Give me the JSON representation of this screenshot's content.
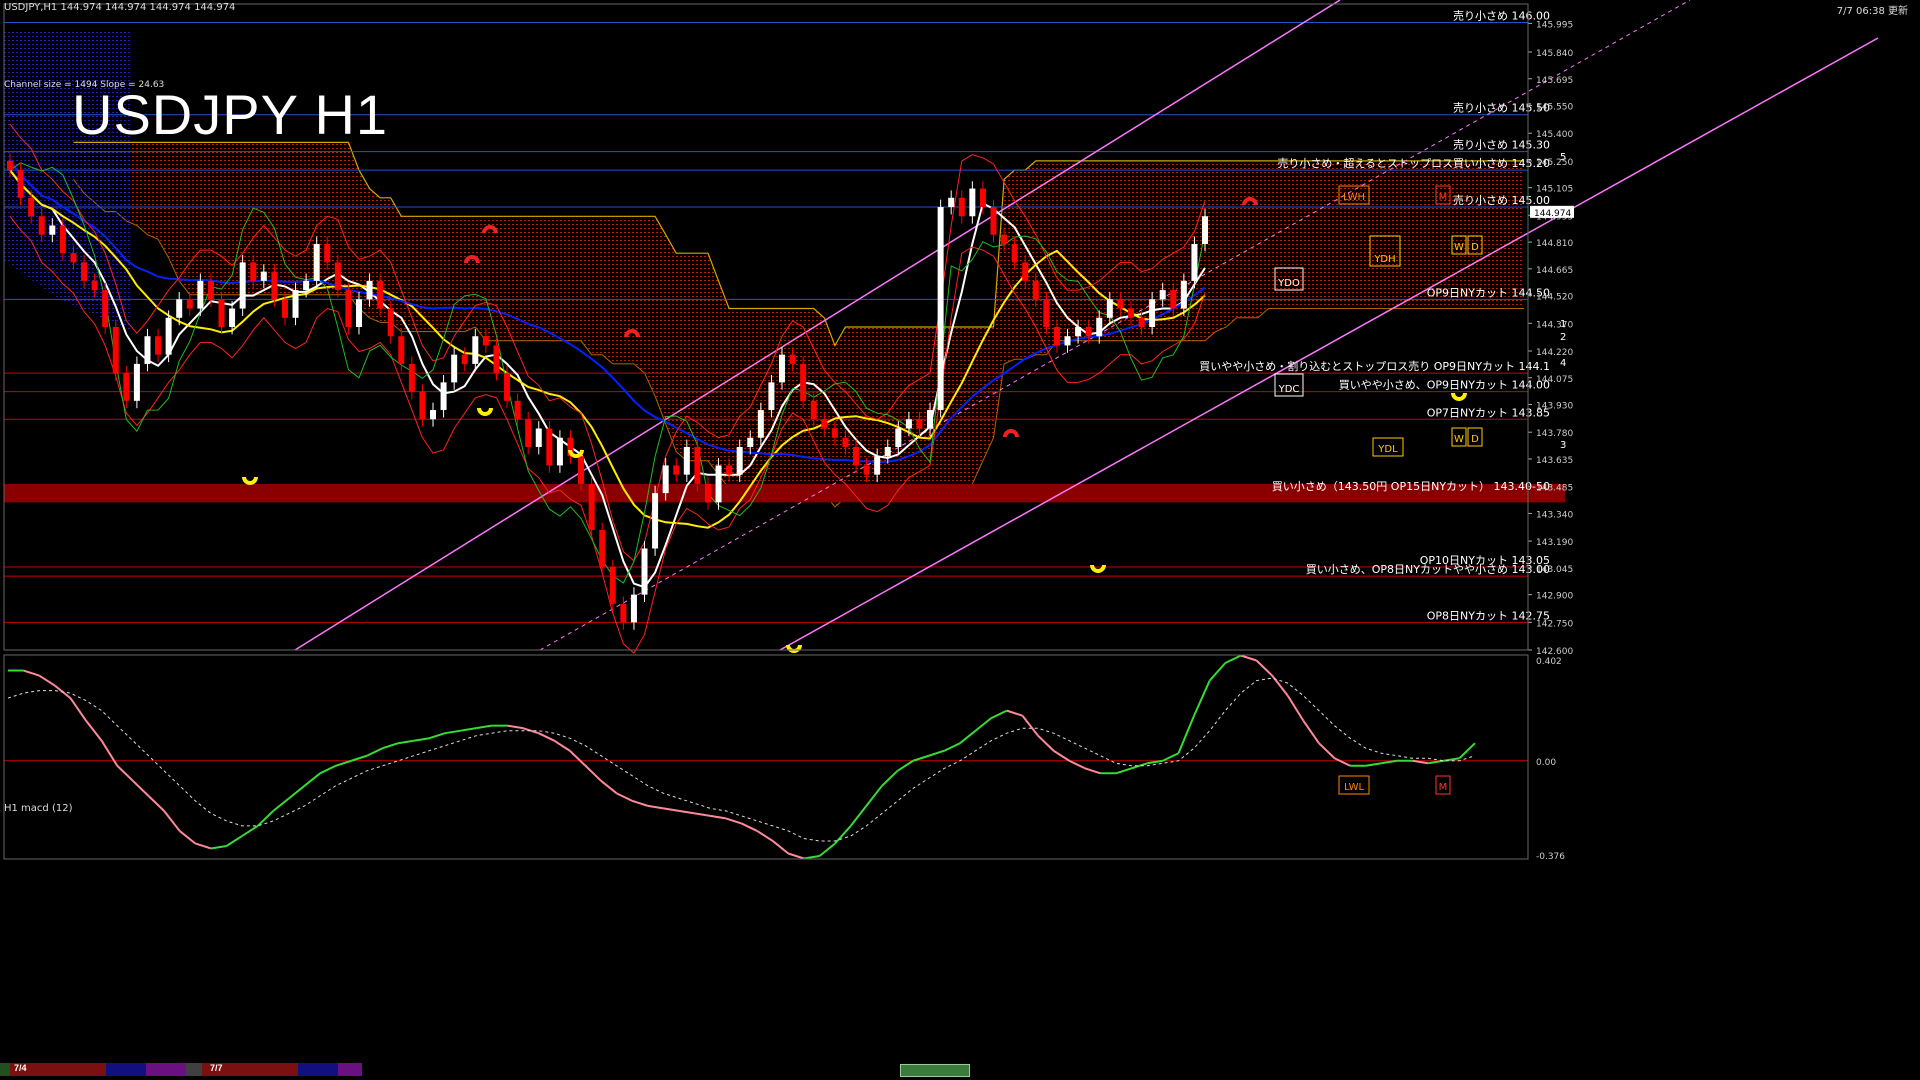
{
  "header": {
    "symbol_line": "USDJPY,H1  144.974 144.974 144.974 144.974",
    "title": "USDJPY H1",
    "channel_info": "Channel size = 1494 Slope = 24.63",
    "clock": "7/7 06:38 更新",
    "macd_label": "H1  macd (12)",
    "date_labels": [
      "7/4",
      "7/7"
    ]
  },
  "colors": {
    "background": "#000000",
    "bull_candle": "#ffffff",
    "bear_candle": "#ff0000",
    "sell_line": "#2255cc",
    "buy_line": "#cc0000",
    "channel": "#ff77ff",
    "sma_fast": "#ffffff",
    "sma_slow": "#ffee00",
    "sma_long": "#0022ff",
    "cloud_bear": "#cc2200",
    "cloud_bull": "#2222cc",
    "macd_up": "#33dd33",
    "macd_down": "#ff8899"
  },
  "chart_data": [
    {
      "type": "candlestick",
      "title": "USDJPY H1",
      "ylim": [
        142.6,
        146.1
      ],
      "y_ticks": [
        "145.995",
        "145.840",
        "145.695",
        "145.550",
        "145.400",
        "145.250",
        "145.105",
        "144.955",
        "144.810",
        "144.665",
        "144.520",
        "144.370",
        "144.220",
        "144.075",
        "143.930",
        "143.780",
        "143.635",
        "143.485",
        "143.340",
        "143.190",
        "143.045",
        "142.900",
        "142.750",
        "142.600"
      ],
      "current_price": "144.974",
      "close": [
        145.2,
        145.05,
        144.95,
        144.85,
        144.9,
        144.75,
        144.7,
        144.6,
        144.55,
        144.35,
        144.1,
        143.95,
        144.15,
        144.3,
        144.2,
        144.4,
        144.5,
        144.45,
        144.6,
        144.5,
        144.35,
        144.45,
        144.7,
        144.6,
        144.65,
        144.5,
        144.4,
        144.55,
        144.6,
        144.8,
        144.7,
        144.55,
        144.35,
        144.5,
        144.6,
        144.45,
        144.3,
        144.15,
        144.0,
        143.85,
        143.9,
        144.05,
        144.2,
        144.15,
        144.3,
        144.25,
        144.1,
        143.95,
        143.85,
        143.7,
        143.8,
        143.6,
        143.75,
        143.65,
        143.5,
        143.25,
        143.05,
        142.85,
        142.75,
        142.9,
        143.15,
        143.45,
        143.6,
        143.55,
        143.7,
        143.5,
        143.4,
        143.6,
        143.55,
        143.7,
        143.75,
        143.9,
        144.05,
        144.2,
        144.15,
        143.95,
        143.85,
        143.8,
        143.75,
        143.7,
        143.6,
        143.55,
        143.65,
        143.7,
        143.8,
        143.85,
        143.8,
        143.9,
        145.0,
        145.05,
        144.95,
        145.1,
        145.0,
        144.85,
        144.8,
        144.7,
        144.6,
        144.5,
        144.35,
        144.25,
        144.3,
        144.35,
        144.3,
        144.4,
        144.5,
        144.45,
        144.4,
        144.35,
        144.5,
        144.55,
        144.45,
        144.6,
        144.8,
        144.95
      ],
      "levels": [
        {
          "price": 146.0,
          "label": "売り小さめ 146.00",
          "side": "sell"
        },
        {
          "price": 145.5,
          "label": "売り小さめ 145.50",
          "side": "sell"
        },
        {
          "price": 145.3,
          "label": "売り小さめ 145.30",
          "side": "sell"
        },
        {
          "price": 145.2,
          "label": "売り小さめ・超えるとストップロス買い小さめ 145.20",
          "side": "sell"
        },
        {
          "price": 145.0,
          "label": "売り小さめ 145.00",
          "side": "sell"
        },
        {
          "price": 144.5,
          "label": "OP9日NYカット 144.50",
          "side": "sell"
        },
        {
          "price": 144.1,
          "label": "買いやや小さめ・割り込むとストップロス売り  OP9日NYカット 144.1",
          "side": "buy"
        },
        {
          "price": 144.0,
          "label": "買いやや小さめ、OP9日NYカット 144.00",
          "side": "buy"
        },
        {
          "price": 143.85,
          "label": "OP7日NYカット 143.85",
          "side": "buy"
        },
        {
          "price": 143.45,
          "label": "買い小さめ（143.50円  OP15日NYカット） 143.40-50",
          "side": "buy"
        },
        {
          "price": 143.05,
          "label": "OP10日NYカット 143.05",
          "side": "buy"
        },
        {
          "price": 143.0,
          "label": "買い小さめ、OP8日NYカットやや小さめ 143.00",
          "side": "buy"
        },
        {
          "price": 142.75,
          "label": "OP8日NYカット 142.75",
          "side": "buy"
        }
      ],
      "markers": [
        "YDO",
        "YDH",
        "YDC",
        "YDL",
        "LWH",
        "LWL",
        "W",
        "D",
        "M"
      ],
      "fib_numbers": [
        "5",
        "1",
        "2",
        "4",
        "3"
      ]
    },
    {
      "type": "line",
      "title": "H1  macd (12)",
      "ylim": [
        -0.376,
        0.402
      ],
      "y_ticks": [
        "0.402",
        "0.00",
        "-0.376"
      ],
      "macd": [
        0.36,
        0.36,
        0.34,
        0.3,
        0.25,
        0.16,
        0.08,
        -0.02,
        -0.08,
        -0.14,
        -0.2,
        -0.28,
        -0.33,
        -0.35,
        -0.34,
        -0.3,
        -0.26,
        -0.2,
        -0.15,
        -0.1,
        -0.05,
        -0.02,
        0.0,
        0.02,
        0.05,
        0.07,
        0.08,
        0.09,
        0.11,
        0.12,
        0.13,
        0.14,
        0.14,
        0.13,
        0.11,
        0.08,
        0.04,
        -0.02,
        -0.08,
        -0.13,
        -0.16,
        -0.18,
        -0.19,
        -0.2,
        -0.21,
        -0.22,
        -0.23,
        -0.25,
        -0.28,
        -0.32,
        -0.37,
        -0.39,
        -0.38,
        -0.33,
        -0.26,
        -0.18,
        -0.1,
        -0.04,
        0.0,
        0.02,
        0.04,
        0.07,
        0.12,
        0.17,
        0.2,
        0.18,
        0.1,
        0.04,
        0.0,
        -0.03,
        -0.05,
        -0.05,
        -0.03,
        -0.01,
        0.0,
        0.03,
        0.18,
        0.32,
        0.39,
        0.42,
        0.4,
        0.34,
        0.26,
        0.16,
        0.07,
        0.01,
        -0.02,
        -0.02,
        -0.01,
        0.0,
        0.0,
        -0.01,
        0.0,
        0.01,
        0.07
      ],
      "signal": [
        0.25,
        0.27,
        0.28,
        0.28,
        0.27,
        0.24,
        0.2,
        0.14,
        0.08,
        0.02,
        -0.04,
        -0.1,
        -0.16,
        -0.21,
        -0.24,
        -0.26,
        -0.26,
        -0.24,
        -0.21,
        -0.18,
        -0.14,
        -0.1,
        -0.07,
        -0.04,
        -0.02,
        0.0,
        0.02,
        0.04,
        0.06,
        0.08,
        0.1,
        0.11,
        0.12,
        0.12,
        0.12,
        0.11,
        0.09,
        0.06,
        0.02,
        -0.02,
        -0.06,
        -0.1,
        -0.13,
        -0.15,
        -0.17,
        -0.19,
        -0.2,
        -0.22,
        -0.24,
        -0.26,
        -0.28,
        -0.31,
        -0.32,
        -0.32,
        -0.3,
        -0.26,
        -0.21,
        -0.16,
        -0.11,
        -0.07,
        -0.03,
        0.0,
        0.04,
        0.08,
        0.11,
        0.13,
        0.13,
        0.11,
        0.08,
        0.05,
        0.02,
        -0.01,
        -0.02,
        -0.02,
        -0.01,
        0.0,
        0.05,
        0.12,
        0.2,
        0.27,
        0.32,
        0.33,
        0.31,
        0.26,
        0.2,
        0.14,
        0.09,
        0.05,
        0.03,
        0.02,
        0.01,
        0.01,
        0.0,
        0.0,
        0.02
      ]
    }
  ]
}
